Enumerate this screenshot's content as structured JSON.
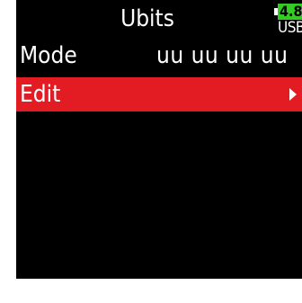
{
  "title": "Ubits",
  "battery": {
    "voltage": "4.8",
    "source": "USB",
    "color": "#33cc22"
  },
  "menu": {
    "items": [
      {
        "label": "Mode",
        "value": "uu uu uu uu"
      },
      {
        "label": "Edit",
        "arrow_icon": "triangle-right-icon"
      }
    ],
    "selected_index": 1,
    "highlight_color": "#e31b23"
  }
}
